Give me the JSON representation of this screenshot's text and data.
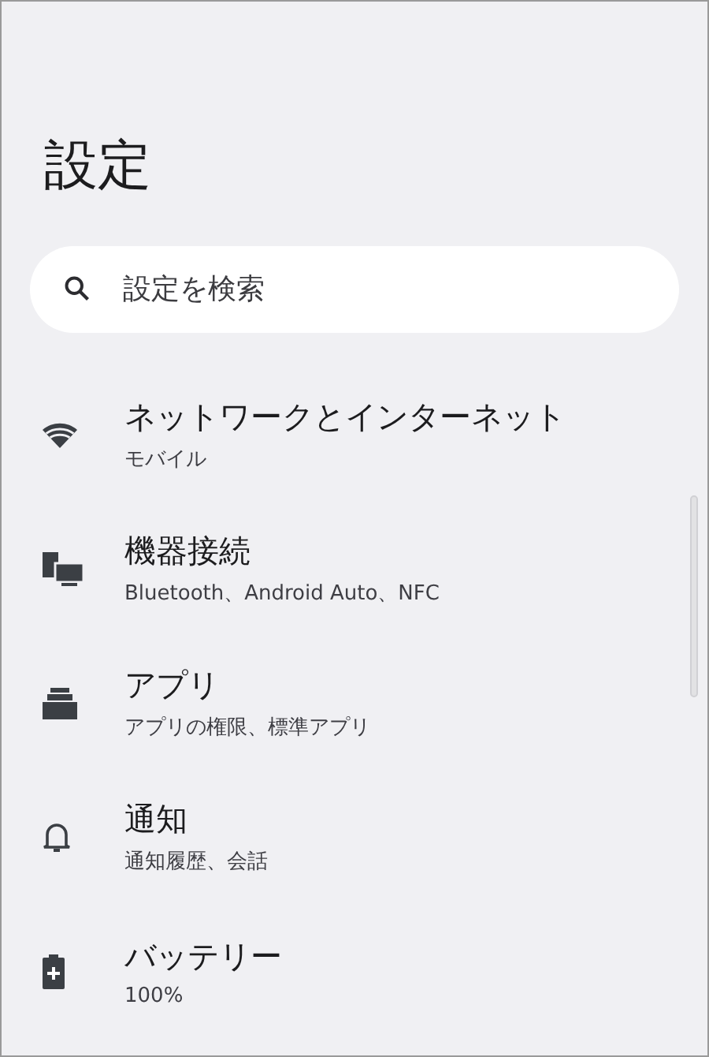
{
  "title": "設定",
  "search": {
    "placeholder": "設定を検索"
  },
  "items": [
    {
      "title": "ネットワークとインターネット",
      "subtitle": "モバイル"
    },
    {
      "title": "機器接続",
      "subtitle": "Bluetooth、Android Auto、NFC"
    },
    {
      "title": "アプリ",
      "subtitle": "アプリの権限、標準アプリ"
    },
    {
      "title": "通知",
      "subtitle": "通知履歴、会話"
    },
    {
      "title": "バッテリー",
      "subtitle": "100%"
    }
  ]
}
